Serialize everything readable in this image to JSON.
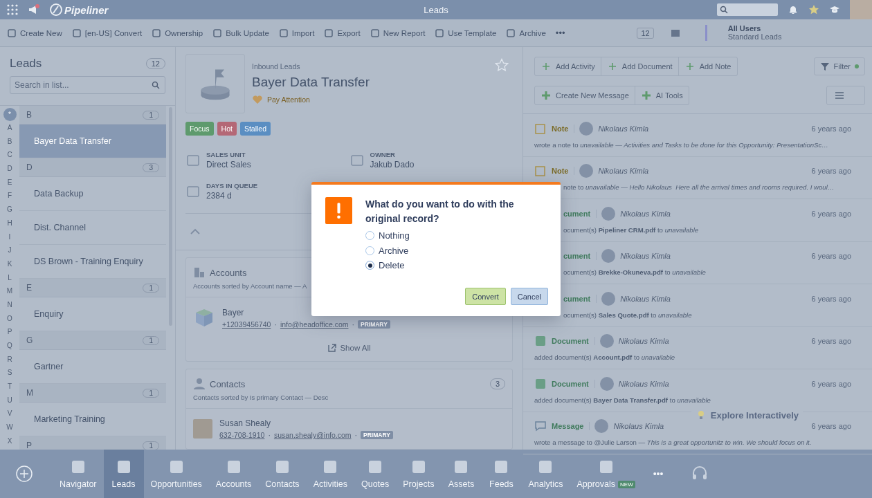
{
  "top_bar": {
    "app_name": "Pipeliner",
    "title": "Leads"
  },
  "toolbar": {
    "actions": [
      "Create New",
      "[en-US] Convert",
      "Ownership",
      "Bulk Update",
      "Import",
      "Export",
      "New Report",
      "Use Template",
      "Archive"
    ],
    "more": "•••",
    "count": "12",
    "view": {
      "title": "All Users",
      "subtitle": "Standard Leads"
    }
  },
  "leads_list": {
    "title": "Leads",
    "count": "12",
    "search": {
      "placeholder": "Search in list..."
    },
    "alphabet": [
      {
        "letter": "*",
        "selected": true
      },
      {
        "letter": "A",
        "selected": false
      },
      {
        "letter": "B",
        "selected": false
      },
      {
        "letter": "C",
        "selected": false
      },
      {
        "letter": "D",
        "selected": false
      },
      {
        "letter": "E",
        "selected": false
      },
      {
        "letter": "F",
        "selected": false
      },
      {
        "letter": "G",
        "selected": false
      },
      {
        "letter": "H",
        "selected": false
      },
      {
        "letter": "I",
        "selected": false
      },
      {
        "letter": "J",
        "selected": false
      },
      {
        "letter": "K",
        "selected": false
      },
      {
        "letter": "L",
        "selected": false
      },
      {
        "letter": "M",
        "selected": false
      },
      {
        "letter": "N",
        "selected": false
      },
      {
        "letter": "O",
        "selected": false
      },
      {
        "letter": "P",
        "selected": false
      },
      {
        "letter": "Q",
        "selected": false
      },
      {
        "letter": "R",
        "selected": false
      },
      {
        "letter": "S",
        "selected": false
      },
      {
        "letter": "T",
        "selected": false
      },
      {
        "letter": "U",
        "selected": false
      },
      {
        "letter": "V",
        "selected": false
      },
      {
        "letter": "W",
        "selected": false
      },
      {
        "letter": "X",
        "selected": false
      }
    ],
    "groups": [
      {
        "letter": "B",
        "count": "1",
        "items": [
          {
            "name": "Bayer Data Transfer",
            "selected": true
          }
        ]
      },
      {
        "letter": "D",
        "count": "3",
        "items": [
          {
            "name": "Data Backup",
            "selected": false
          },
          {
            "name": "Dist. Channel",
            "selected": false
          },
          {
            "name": "DS Brown - Training Enquiry",
            "selected": false
          }
        ]
      },
      {
        "letter": "E",
        "count": "1",
        "items": [
          {
            "name": "Enquiry",
            "selected": false
          }
        ]
      },
      {
        "letter": "G",
        "count": "1",
        "items": [
          {
            "name": "Gartner",
            "selected": false
          }
        ]
      },
      {
        "letter": "M",
        "count": "1",
        "items": [
          {
            "name": "Marketing Training",
            "selected": false
          }
        ]
      },
      {
        "letter": "P",
        "count": "1"
      }
    ]
  },
  "detail": {
    "category": "Inbound Leads",
    "title": "Bayer Data Transfer",
    "health": "Pay Attention",
    "tags": [
      {
        "label": "Focus",
        "color": "#5e9a6d"
      },
      {
        "label": "Hot",
        "color": "#b46876"
      },
      {
        "label": "Stalled",
        "color": "#5a8ec2"
      }
    ],
    "fields": [
      {
        "label": "SALES UNIT",
        "value": "Direct Sales"
      },
      {
        "label": "OWNER",
        "value": "Jakub Dado"
      },
      {
        "label": "DAYS IN QUEUE",
        "value": "2384 d"
      }
    ],
    "accounts": {
      "title": "Accounts",
      "sort_note": "Accounts sorted by Account name — A",
      "items": [
        {
          "name": "Bayer",
          "phone": "+12039456740",
          "separator": "·",
          "email": "info@headoffice.com",
          "badge": "PRIMARY"
        }
      ],
      "show_all": "Show All"
    },
    "contacts": {
      "title": "Contacts",
      "sort_note": "Contacts sorted by Is primary Contact — Desc",
      "count": "3",
      "items": [
        {
          "name": "Susan Shealy",
          "phone": "632-708-1910",
          "separator": "·",
          "email": "susan.shealy@info.com",
          "badge": "PRIMARY"
        }
      ]
    }
  },
  "feed": {
    "actions": [
      "Add Activity",
      "Add Document",
      "Add Note"
    ],
    "filter": "Filter",
    "actions2": [
      "Create New Message",
      "AI Tools"
    ],
    "items": [
      {
        "kind": "note",
        "type": "Note",
        "author": "Nikolaus Kimla",
        "time": "6 years ago",
        "text": "wrote a note to *unavailable — Activities and Tasks to be done for this Opportunity: PresentationSc…*",
        "header_covered": false,
        "text_covered": false
      },
      {
        "kind": "note",
        "type": "Note",
        "author": "Nikolaus Kimla",
        "time": "6 years ago",
        "text": "note to *unavailable — Hello Nikolaus  Here all the arrival times and rooms required. I woul…*",
        "header_covered": false,
        "text_covered": true
      },
      {
        "kind": "document",
        "type": "cument",
        "author": "Nikolaus Kimla",
        "time": "6 years ago",
        "text": "ocument(s) **Pipeliner CRM.pdf** to *unavailable*",
        "header_covered": true,
        "text_covered": true
      },
      {
        "kind": "document",
        "type": "cument",
        "author": "Nikolaus Kimla",
        "time": "6 years ago",
        "text": "ocument(s) **Brekke-Okuneva.pdf** to *unavailable*",
        "header_covered": true,
        "text_covered": true
      },
      {
        "kind": "document",
        "type": "cument",
        "author": "Nikolaus Kimla",
        "time": "6 years ago",
        "text": "ocument(s) **Sales Quote.pdf** to *unavailable*",
        "header_covered": true,
        "text_covered": true
      },
      {
        "kind": "document",
        "type": "Document",
        "author": "Nikolaus Kimla",
        "time": "6 years ago",
        "text": "added document(s) **Account.pdf** to *unavailable*",
        "header_covered": false,
        "text_covered": false
      },
      {
        "kind": "document",
        "type": "Document",
        "author": "Nikolaus Kimla",
        "time": "6 years ago",
        "text": "added document(s) **Bayer Data Transfer.pdf** to *unavailable*",
        "header_covered": false,
        "text_covered": false
      },
      {
        "kind": "message",
        "type": "Message",
        "author": "Nikolaus Kimla",
        "time": "6 years ago",
        "text": "wrote a message to @Julie Larson — *This is a great opportunitz to win. We should focus on it.*",
        "header_covered": false,
        "text_covered": false
      }
    ],
    "explore": "Explore Interactively"
  },
  "bottom_nav": {
    "items": [
      {
        "label": "Navigator",
        "selected": false
      },
      {
        "label": "Leads",
        "selected": true
      },
      {
        "label": "Opportunities",
        "selected": false
      },
      {
        "label": "Accounts",
        "selected": false
      },
      {
        "label": "Contacts",
        "selected": false
      },
      {
        "label": "Activities",
        "selected": false
      },
      {
        "label": "Quotes",
        "selected": false
      },
      {
        "label": "Projects",
        "selected": false
      },
      {
        "label": "Assets",
        "selected": false
      },
      {
        "label": "Feeds",
        "selected": false
      },
      {
        "label": "Analytics",
        "selected": false
      },
      {
        "label": "Approvals",
        "selected": false,
        "badge": "NEW"
      }
    ],
    "more": "•••"
  },
  "dialog": {
    "message": "What do you want to do with the original record?",
    "options": [
      {
        "label": "Nothing",
        "selected": false
      },
      {
        "label": "Archive",
        "selected": false
      },
      {
        "label": "Delete",
        "selected": true
      }
    ],
    "buttons": [
      {
        "label": "Convert",
        "kind": "primary"
      },
      {
        "label": "Cancel",
        "kind": "secondary"
      }
    ]
  }
}
